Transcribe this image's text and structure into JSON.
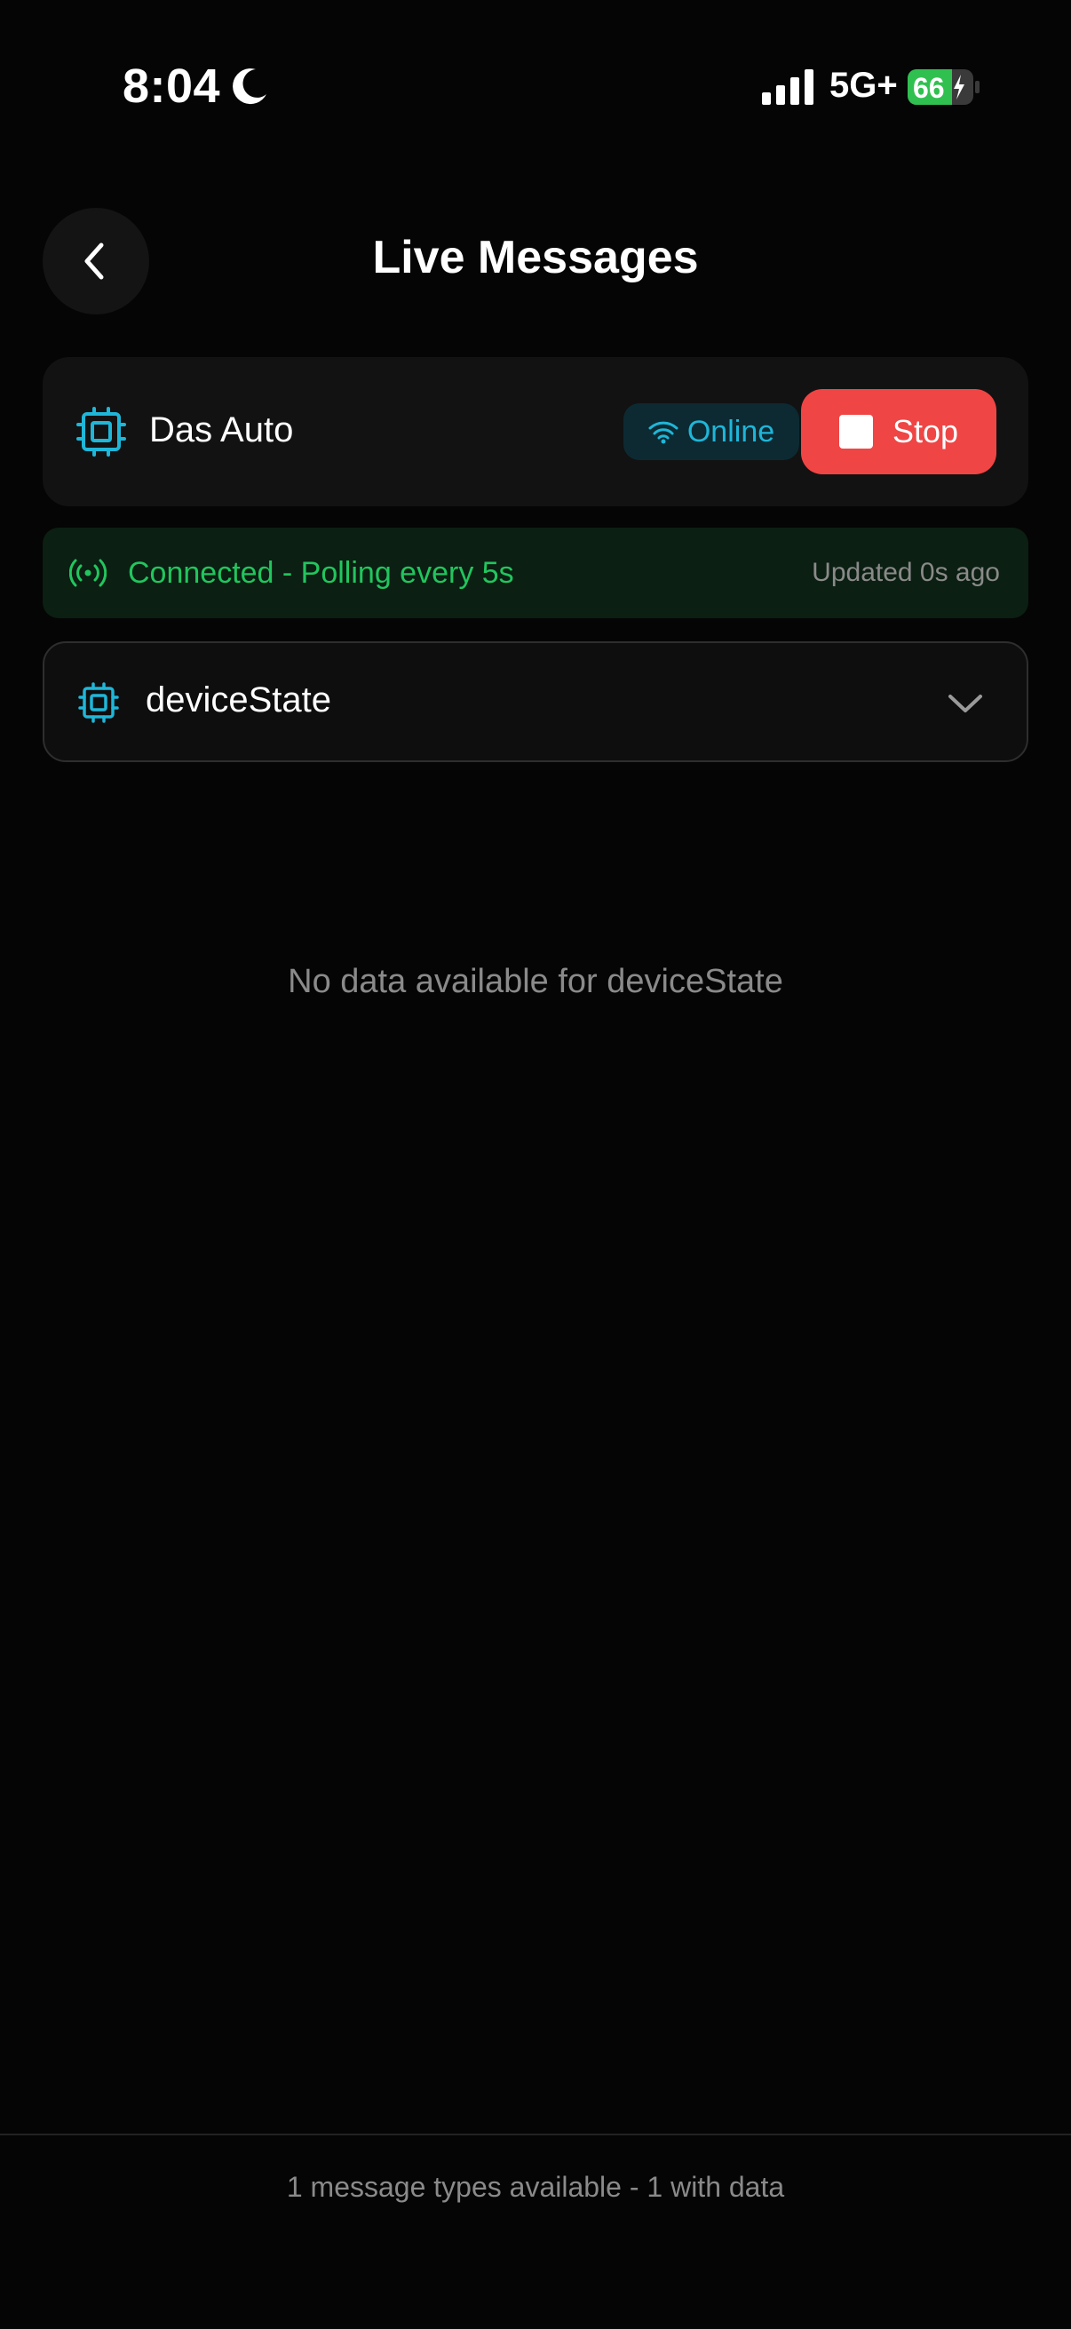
{
  "status_bar": {
    "time": "8:04",
    "network": "5G+",
    "battery": "66",
    "icons": [
      "moon-icon",
      "signal-icon",
      "battery-charging-icon"
    ]
  },
  "header": {
    "title": "Live Messages",
    "back_icon": "chevron-left-icon"
  },
  "device": {
    "name": "Das Auto",
    "icon": "chip-icon",
    "status": "Online",
    "status_icon": "wifi-icon",
    "stop_label": "Stop"
  },
  "connection": {
    "message": "Connected - Polling every 5s",
    "updated": "Updated 0s ago",
    "icon": "antenna-icon"
  },
  "selector": {
    "value": "deviceState",
    "icon": "chip-icon",
    "dropdown_icon": "chevron-down-icon"
  },
  "empty_state": {
    "message": "No data available for deviceState"
  },
  "footer": {
    "summary": "1 message types available - 1 with data"
  },
  "colors": {
    "background": "#050505",
    "accent_cyan": "#1fb6d8",
    "success_green": "#22c55e",
    "danger_red": "#ef4545",
    "muted_text": "#8a8a8a"
  }
}
